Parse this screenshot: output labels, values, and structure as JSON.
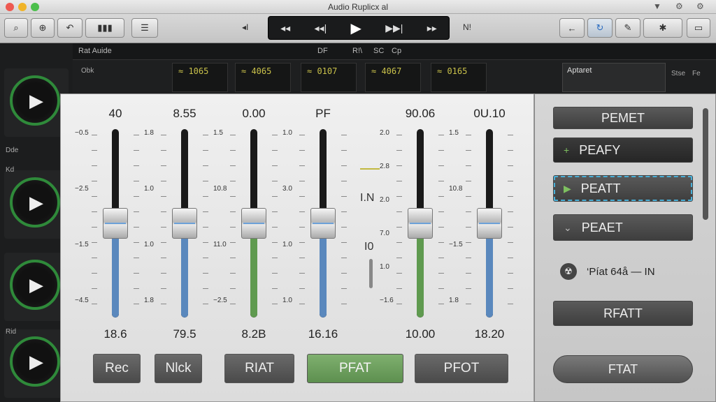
{
  "window": {
    "title": "Audio Ruplicx al",
    "controls": [
      "close",
      "minimize",
      "zoom"
    ],
    "right_icons": [
      "dropdown-icon",
      "gear-icon",
      "gear-icon"
    ]
  },
  "toolbar": {
    "left_buttons": [
      "search-icon",
      "target-icon",
      "undo-icon",
      "waveform-icon",
      "list-icon"
    ],
    "transport_label_left": "◂I",
    "transport": [
      "rewind",
      "skip-back",
      "play",
      "skip-forward",
      "fast-forward"
    ],
    "transport_label_right": "N!",
    "right_buttons": [
      "back-icon",
      "loop-icon",
      "brush-icon",
      "tools-icon",
      "window-icon"
    ]
  },
  "background": {
    "tab_label": "Rat Auide",
    "top_indicators": [
      "DF",
      "R!\\",
      "SC",
      "Cp"
    ],
    "meters": [
      "≈ 1065",
      "≈ 4065",
      "≈ 0107",
      "≈ 4067",
      "≈ 0165"
    ],
    "left_labels": [
      "Obk",
      "Dde",
      "Kd",
      "Rid"
    ],
    "right_panel_label": "Aptaret",
    "right_labels": [
      "Stse",
      "Fe"
    ]
  },
  "mixer": {
    "channels": [
      {
        "top": "40",
        "bottom": "18.6",
        "level": 0.5,
        "fill": "#5a88bd",
        "scale": [
          "−0.5",
          "−2.5",
          "−1.5",
          "−4.5"
        ]
      },
      {
        "top": "8.55",
        "bottom": "79.5",
        "level": 0.5,
        "fill": "#5a88bd",
        "scale": [
          "1.8",
          "1.0",
          "1.0",
          "1.8"
        ]
      },
      {
        "top": "0.00",
        "bottom": "8.2B",
        "level": 0.5,
        "fill": "#5f9a4f",
        "scale": [
          "1.5",
          "10.8",
          "11.0",
          "−2.5"
        ]
      },
      {
        "top": "PF",
        "bottom": "16.16",
        "level": 0.5,
        "fill": "#5a88bd",
        "scale": [
          "1.0",
          "3.0",
          "1.0",
          "1.0"
        ]
      },
      {
        "top": "90.06",
        "bottom": "10.00",
        "level": 0.5,
        "fill": "#5f9a4f",
        "scale": [
          "2.0",
          "2.8",
          "2.0",
          "7.0",
          "1.0",
          "−1.6"
        ]
      },
      {
        "top": "0U.10",
        "bottom": "18.20",
        "level": 0.5,
        "fill": "#5a88bd",
        "scale": [
          "1.5",
          "10.8",
          "−1.5",
          "1.8"
        ]
      }
    ],
    "mid_labels": [
      "I.N",
      "I0"
    ],
    "buttons": [
      {
        "label": "Rec",
        "active": false
      },
      {
        "label": "Nlck",
        "active": false
      },
      {
        "label": "RIAT",
        "active": false
      },
      {
        "label": "PFAT",
        "active": true
      },
      {
        "label": "PFOT",
        "active": false
      }
    ]
  },
  "presets": {
    "items": [
      {
        "label": "PEMET",
        "icon": ""
      },
      {
        "label": "PEAFY",
        "icon": "+"
      },
      {
        "label": "PEATT",
        "icon": "▶"
      },
      {
        "label": "PEAET",
        "icon": "⌄"
      }
    ],
    "info": "‘Píat 64å —  IN",
    "rfatt": "RFATT",
    "ftat": "FTAT"
  }
}
